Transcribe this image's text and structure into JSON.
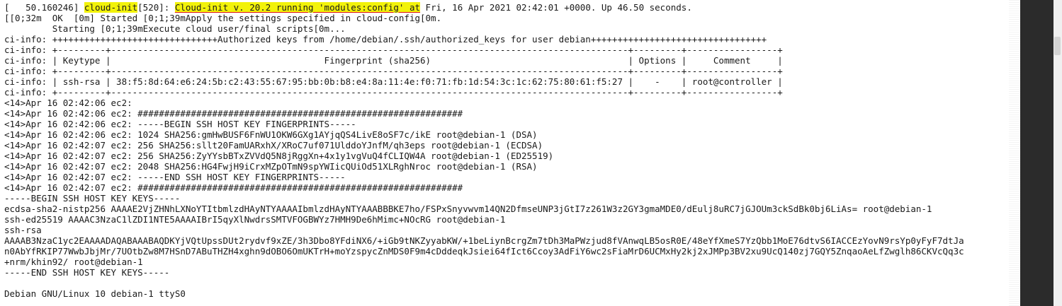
{
  "console": {
    "line_1": {
      "prefix": "[   50.160246] ",
      "tag": "cloud-init",
      "mid": "[520]: ",
      "version": "Cloud-init v. 20.2 running 'modules:config' at",
      "rest": " Fri, 16 Apr 2021 02:42:01 +0000. Up 46.50 seconds."
    },
    "lines": [
      "[[0;32m  OK  [0m] Started [0;1;39mApply the settings specified in cloud-config[0m.",
      "         Starting [0;1;39mExecute cloud user/final scripts[0m...",
      "ci-info: +++++++++++++++++++++++++++++++Authorized keys from /home/debian/.ssh/authorized_keys for user debian+++++++++++++++++++++++++++++++++",
      "ci-info: +---------+-------------------------------------------------------------------------------------------------+---------+-----------------+",
      "ci-info: | Keytype |                                        Fingerprint (sha256)                                     | Options |     Comment     |",
      "ci-info: +---------+-------------------------------------------------------------------------------------------------+---------+-----------------+",
      "ci-info: | ssh-rsa | 38:f5:8d:64:e6:24:5b:c2:43:55:67:95:bb:0b:b8:e4:8a:11:4e:f0:71:fb:1d:54:3c:1c:62:75:80:61:f5:27 |    -    | root@controller |",
      "ci-info: +---------+-------------------------------------------------------------------------------------------------+---------+-----------------+",
      "<14>Apr 16 02:42:06 ec2:",
      "<14>Apr 16 02:42:06 ec2: #############################################################",
      "<14>Apr 16 02:42:06 ec2: -----BEGIN SSH HOST KEY FINGERPRINTS-----",
      "<14>Apr 16 02:42:06 ec2: 1024 SHA256:gmHwBUSF6FnWU1OKW6GXg1AYjqQS4LivE8oSF7c/ikE root@debian-1 (DSA)",
      "<14>Apr 16 02:42:07 ec2: 256 SHA256:sllt20FamUARxhX/XRoC7uf071UlddoYJnfM/qh3eps root@debian-1 (ECDSA)",
      "<14>Apr 16 02:42:07 ec2: 256 SHA256:ZyYYsbBTxZVVdQ5N8jRggXn+4x1y1vgVuQ4fCLIQW4A root@debian-1 (ED25519)",
      "<14>Apr 16 02:42:07 ec2: 2048 SHA256:HG4FwjH9iCrxMZpOTmN9spYWIicQUiOd51XLRghNroc root@debian-1 (RSA)",
      "<14>Apr 16 02:42:07 ec2: -----END SSH HOST KEY FINGERPRINTS-----",
      "<14>Apr 16 02:42:07 ec2: #############################################################",
      "-----BEGIN SSH HOST KEY KEYS-----",
      "ecdsa-sha2-nistp256 AAAAE2VjZHNhLXNoYTItbmlzdHAyNTYAAAAIbmlzdHAyNTYAAABBBKE7ho/FSPxSnyvwvm14QN2DfmseUNP3jGtI7z261W3z2GY3gmaMDE0/dEulj8uRC7jGJOUm3ckSdBk0bj6LiAs= root@debian-1",
      "ssh-ed25519 AAAAC3NzaC1lZDI1NTE5AAAAIBrI5qyXlNwdrsSMTVFOGBWYz7HMH9De6hMimc+NOcRG root@debian-1",
      "ssh-rsa",
      "AAAAB3NzaC1yc2EAAAADAQABAAABAQDKYjVQtUpssDUt2rydvf9xZE/3h3Dbo8YFdiNX6/+iGb9tNKZyyabKW/+1beLiynBcrgZm7tDh3MaPWzjud8fVAnwqLB5osR0E/48eYfXmeS7YzQbb1MoE76dtvS6IACCEzYovN9rsYp0yFyF7dtJa",
      "n0AbYfRKIP77WwbJbjMr/7UOtbZw8M7HSnD7ABuTHZH4xghn9dOBO6OmUKTrH+moYzspycZnMDS0F9m4cDddeqkJsiei64fIct6Ccoy3AdFiY6wc2sFiaMrD6UCMxHy2kj2xJMPp3BV2xu9UcQ140zj7GQY5ZnqaoAeLfZwglh86CKVcQq3c",
      "+nrm/khin92/ root@debian-1",
      "-----END SSH HOST KEY KEYS-----",
      "",
      "Debian GNU/Linux 10 debian-1 ttyS0"
    ]
  },
  "colors": {
    "highlight": "#f2f20a",
    "underline": "#dd1111",
    "text": "#1a1a1a",
    "sidebar": "#2b2b2b"
  }
}
